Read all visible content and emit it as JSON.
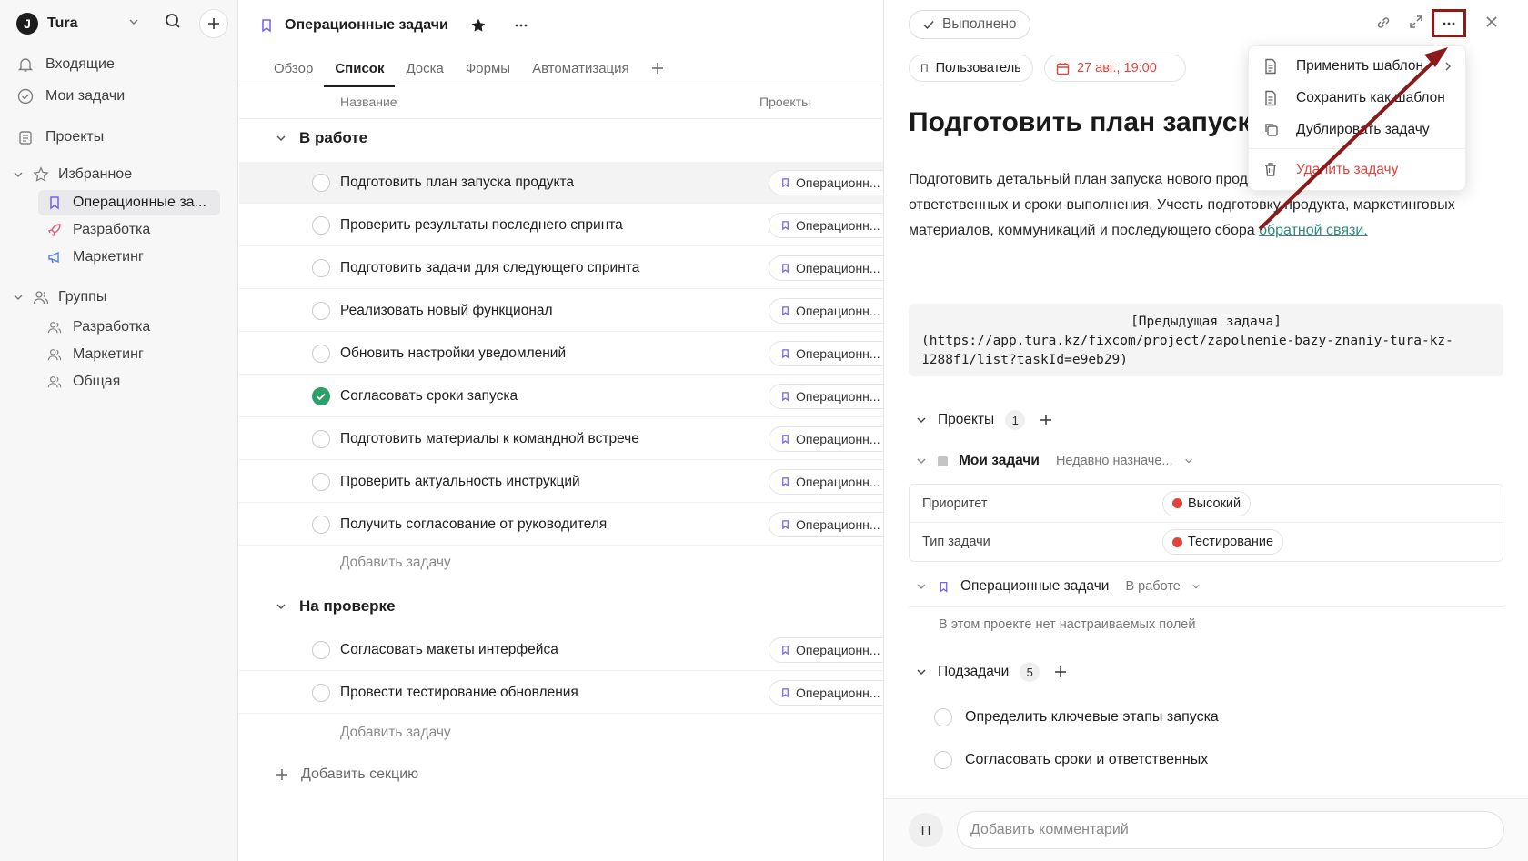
{
  "sidebar": {
    "workspace": "Tura",
    "nav": [
      "Входящие",
      "Мои задачи",
      "Проекты"
    ],
    "favorites_label": "Избранное",
    "favorites": [
      "Операционные за...",
      "Разработка",
      "Маркетинг"
    ],
    "groups_label": "Группы",
    "groups": [
      "Разработка",
      "Маркетинг",
      "Общая"
    ]
  },
  "project": {
    "title": "Операционные задачи",
    "tabs": [
      "Обзор",
      "Список",
      "Доска",
      "Формы",
      "Автоматизация"
    ],
    "col_name": "Название",
    "col_projects": "Проекты",
    "sections": [
      {
        "title": "В работе",
        "tasks": [
          {
            "title": "Подготовить план запуска продукта",
            "done": false
          },
          {
            "title": "Проверить результаты последнего спринта",
            "done": false
          },
          {
            "title": "Подготовить задачи для следующего спринта",
            "done": false
          },
          {
            "title": "Реализовать новый функционал",
            "done": false
          },
          {
            "title": "Обновить настройки уведомлений",
            "done": false
          },
          {
            "title": "Согласовать сроки запуска",
            "done": true
          },
          {
            "title": "Подготовить материалы к командной встрече",
            "done": false
          },
          {
            "title": "Проверить актуальность инструкций",
            "done": false
          },
          {
            "title": "Получить согласование от руководителя",
            "done": false
          }
        ]
      },
      {
        "title": "На проверке",
        "tasks": [
          {
            "title": "Согласовать макеты интерфейса",
            "done": false
          },
          {
            "title": "Провести тестирование обновления",
            "done": false
          }
        ]
      }
    ],
    "project_chip": "Операционн...",
    "add_task": "Добавить задачу",
    "add_section": "Добавить секцию"
  },
  "task": {
    "status_button": "Выполнено",
    "assignee_initial": "П",
    "assignee": "Пользователь",
    "due": "27 авг., 19:00",
    "title": "Подготовить план запуска продукта",
    "description_1": "Подготовить детальный план запуска нового продукта, включая ключевые этапы, ответственных и сроки выполнения. Учесть подготовку продукта, маркетинговых материалов, коммуникаций и последующего сбора ",
    "description_link": "обратной связи.",
    "code_line1": "[Предыдущая задача]",
    "code_line2": "(https://app.tura.kz/fixcom/project/zapolnenie-bazy-znaniy-tura-kz-1288f1/list?taskId=e9eb29)",
    "projects_label": "Проекты",
    "projects_count": "1",
    "my_tasks_label": "Мои задачи",
    "my_tasks_section": "Недавно назначе...",
    "fields": [
      {
        "label": "Приоритет",
        "value": "Высокий"
      },
      {
        "label": "Тип задачи",
        "value": "Тестирование"
      }
    ],
    "op_project": "Операционные задачи",
    "op_section": "В работе",
    "no_fields": "В этом проекте нет настраиваемых полей",
    "subtasks_label": "Подзадачи",
    "subtasks_count": "5",
    "subtasks": [
      "Определить ключевые этапы запуска",
      "Согласовать сроки и ответственных"
    ],
    "comment_avatar": "П",
    "comment_placeholder": "Добавить комментарий"
  },
  "menu": {
    "items": [
      "Применить шаблон",
      "Сохранить как шаблон",
      "Дублировать задачу",
      "Удалить задачу"
    ]
  },
  "colors": {
    "accent": "#8b1a1a",
    "done": "#2e9e6b",
    "danger": "#e0453d",
    "link": "#2e8b7a"
  }
}
